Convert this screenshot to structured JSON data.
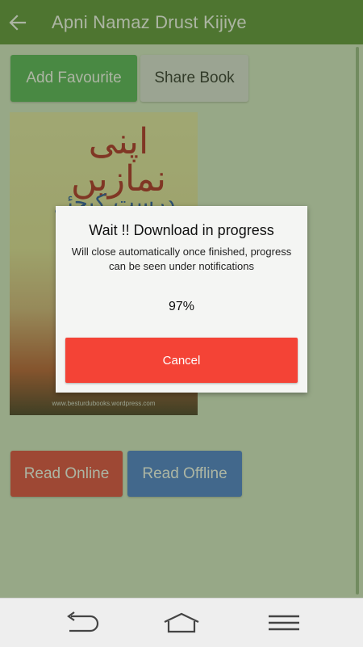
{
  "appbar": {
    "title": "Apni Namaz Drust Kijiye",
    "back_icon": "arrow-left-icon"
  },
  "actions": {
    "add_favourite": "Add Favourite",
    "share_book": "Share Book"
  },
  "cover": {
    "title_urdu": "اپنی نمازیں",
    "subtitle_urdu": "درست کیجئے",
    "website": "www.besturdubooks.wordpress.com"
  },
  "read_buttons": {
    "read_online": "Read Online",
    "read_offline": "Read Offline"
  },
  "dialog": {
    "title": "Wait !! Download in progress",
    "message": "Will close automatically once finished, progress can be seen under notifications",
    "progress": "97%",
    "cancel_label": "Cancel"
  },
  "navbar": {
    "back_icon": "nav-back-icon",
    "home_icon": "nav-home-icon",
    "menu_icon": "nav-menu-icon"
  },
  "colors": {
    "appbar": "#558b2f",
    "favourite": "#4caf50",
    "read_online": "#e53935",
    "read_offline": "#3f74d6",
    "cancel": "#f44336"
  }
}
